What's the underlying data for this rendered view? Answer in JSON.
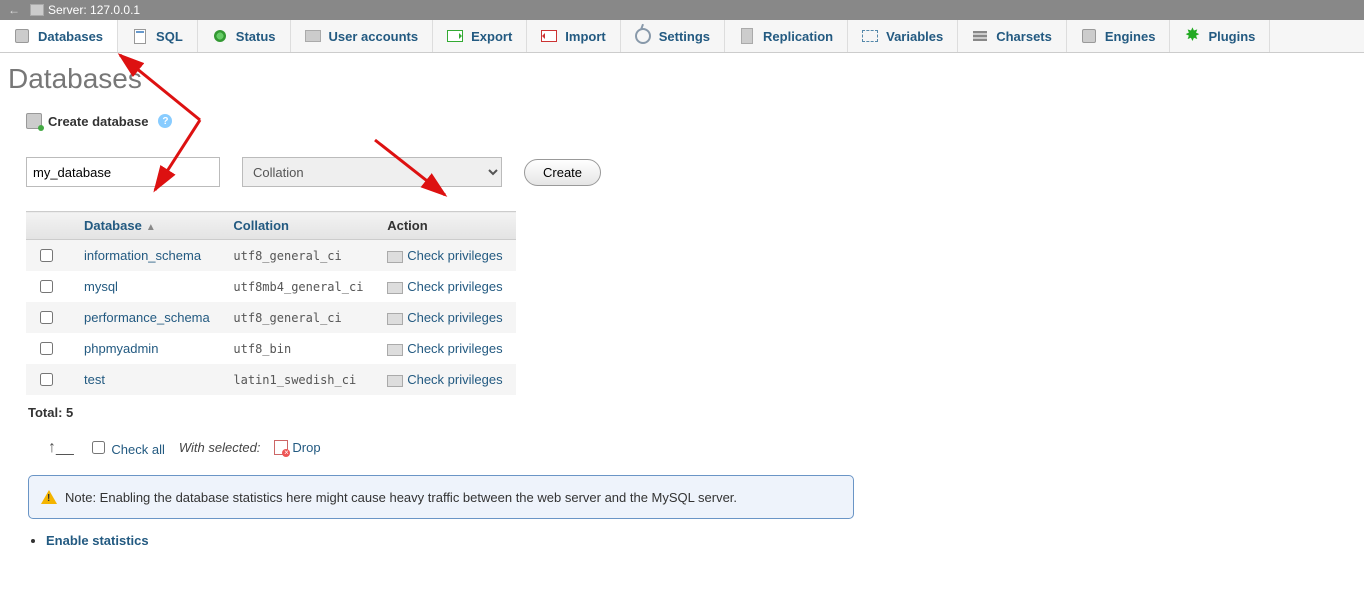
{
  "server": {
    "label": "Server:",
    "host": "127.0.0.1"
  },
  "tabs": [
    {
      "key": "databases",
      "label": "Databases"
    },
    {
      "key": "sql",
      "label": "SQL"
    },
    {
      "key": "status",
      "label": "Status"
    },
    {
      "key": "users",
      "label": "User accounts"
    },
    {
      "key": "export",
      "label": "Export"
    },
    {
      "key": "import",
      "label": "Import"
    },
    {
      "key": "settings",
      "label": "Settings"
    },
    {
      "key": "replication",
      "label": "Replication"
    },
    {
      "key": "variables",
      "label": "Variables"
    },
    {
      "key": "charsets",
      "label": "Charsets"
    },
    {
      "key": "engines",
      "label": "Engines"
    },
    {
      "key": "plugins",
      "label": "Plugins"
    }
  ],
  "page": {
    "title": "Databases"
  },
  "create": {
    "heading": "Create database",
    "name_value": "my_database",
    "collation_placeholder": "Collation",
    "button": "Create"
  },
  "columns": {
    "database": "Database",
    "collation": "Collation",
    "action": "Action"
  },
  "action_label": "Check privileges",
  "rows": [
    {
      "name": "information_schema",
      "collation": "utf8_general_ci"
    },
    {
      "name": "mysql",
      "collation": "utf8mb4_general_ci"
    },
    {
      "name": "performance_schema",
      "collation": "utf8_general_ci"
    },
    {
      "name": "phpmyadmin",
      "collation": "utf8_bin"
    },
    {
      "name": "test",
      "collation": "latin1_swedish_ci"
    }
  ],
  "total": {
    "label": "Total:",
    "count": "5"
  },
  "checkall": {
    "label": "Check all",
    "with_label": "With selected:",
    "drop": "Drop"
  },
  "notice": "Note: Enabling the database statistics here might cause heavy traffic between the web server and the MySQL server.",
  "enable_stats": "Enable statistics"
}
